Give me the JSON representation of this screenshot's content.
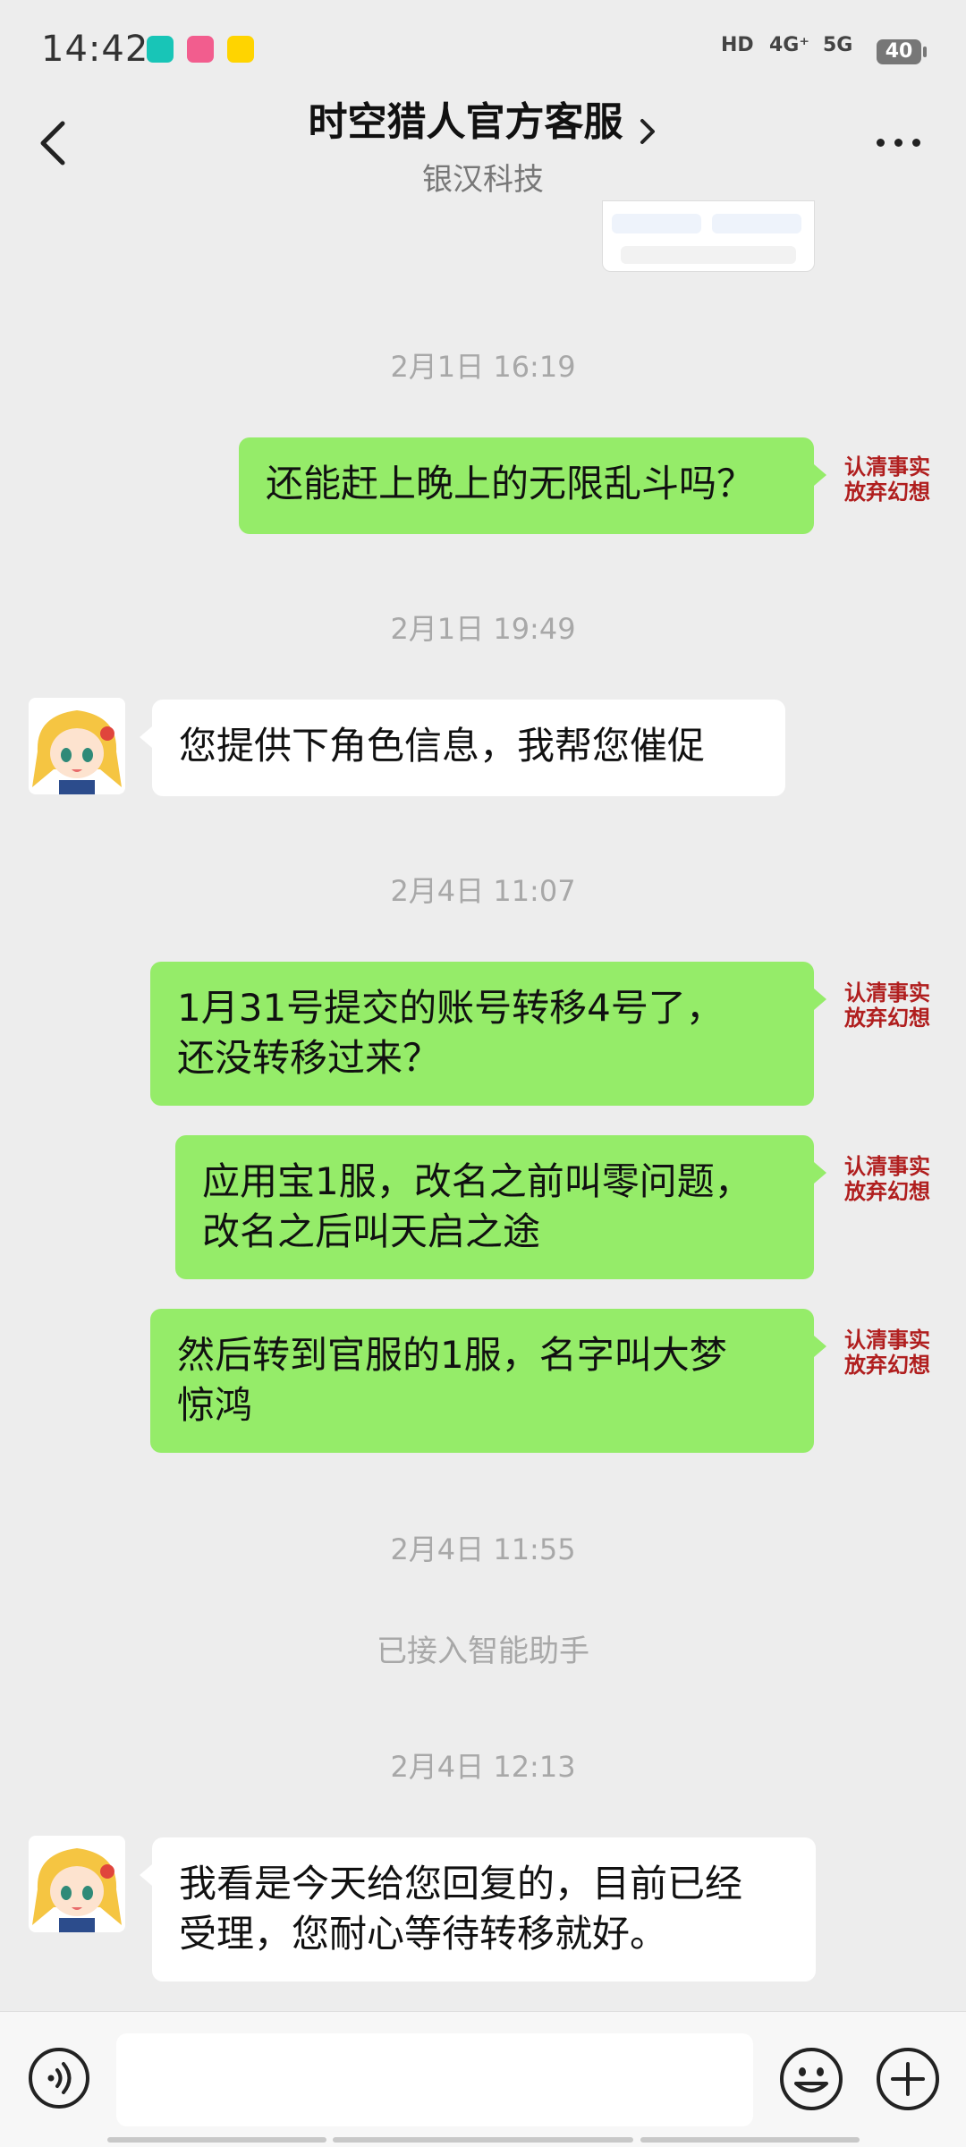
{
  "status_bar": {
    "time": "14:42",
    "app_icons": [
      "Top",
      "bilibili",
      "刷圈"
    ],
    "network": {
      "hd": "HD",
      "sim1": "4G⁺",
      "sim2": "5G"
    },
    "battery": "40"
  },
  "header": {
    "title": "时空猎人官方客服",
    "subtitle": "银汉科技",
    "icons": {
      "back": "back-arrow-icon",
      "title_chevron": "chevron-right-icon",
      "more": "more-dots-icon"
    }
  },
  "sticker_text": {
    "line1": "认清事实",
    "line2": "放弃幻想"
  },
  "messages": [
    {
      "kind": "timestamp",
      "text": "2月1日 16:19"
    },
    {
      "kind": "outgoing",
      "text": "还能赶上晚上的无限乱斗吗？"
    },
    {
      "kind": "timestamp",
      "text": "2月1日 19:49"
    },
    {
      "kind": "incoming",
      "text": "您提供下角色信息，我帮您催促"
    },
    {
      "kind": "timestamp",
      "text": "2月4日 11:07"
    },
    {
      "kind": "outgoing",
      "text": "1月31号提交的账号转移4号了，\n还没转移过来？"
    },
    {
      "kind": "outgoing",
      "text": "应用宝1服，改名之前叫零问题，\n改名之后叫天启之途"
    },
    {
      "kind": "outgoing",
      "text": "然后转到官服的1服，名字叫大梦\n惊鸿"
    },
    {
      "kind": "timestamp",
      "text": "2月4日 11:55"
    },
    {
      "kind": "system",
      "text": "已接入智能助手"
    },
    {
      "kind": "timestamp",
      "text": "2月4日 12:13"
    },
    {
      "kind": "incoming",
      "text": "我看是今天给您回复的，目前已经\n受理，您耐心等待转移就好。"
    }
  ],
  "bottom_bar": {
    "icons": {
      "voice": "voice-input-icon",
      "mic": "microphone-icon",
      "emoji": "emoji-icon",
      "plus": "plus-icon"
    },
    "input_value": ""
  },
  "colors": {
    "background": "#ededed",
    "outgoing_bubble": "#95ec69",
    "incoming_bubble": "#ffffff",
    "sticker_text": "#b01e1e"
  }
}
